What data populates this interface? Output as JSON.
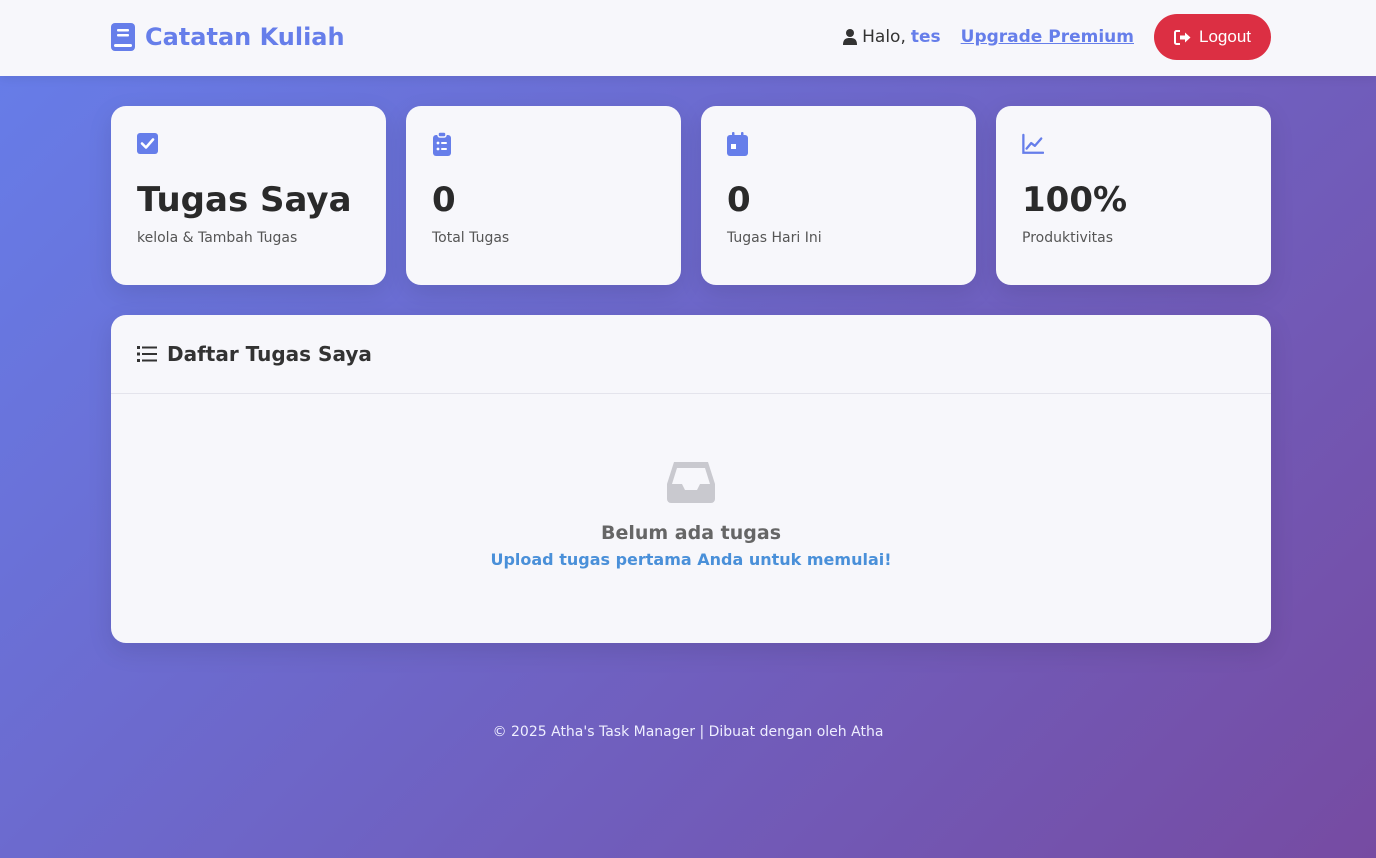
{
  "nav": {
    "brand": "Catatan Kuliah",
    "greeting": "Halo,",
    "username": "tes",
    "upgrade": "Upgrade Premium",
    "logout": "Logout"
  },
  "stats": [
    {
      "value": "Tugas Saya",
      "label": "kelola & Tambah Tugas",
      "icon": "check-square-icon"
    },
    {
      "value": "0",
      "label": "Total Tugas",
      "icon": "clipboard-list-icon"
    },
    {
      "value": "0",
      "label": "Tugas Hari Ini",
      "icon": "calendar-icon"
    },
    {
      "value": "100%",
      "label": "Produktivitas",
      "icon": "chart-line-icon"
    }
  ],
  "panel": {
    "title": "Daftar Tugas Saya",
    "empty_title": "Belum ada tugas",
    "empty_sub": "Upload tugas pertama Anda untuk memulai!"
  },
  "footer": "© 2025 Atha's Task Manager | Dibuat dengan oleh Atha",
  "colors": {
    "accent": "#667eea",
    "gradient_end": "#764ba2",
    "logout": "#dc2f43",
    "link": "#4a90d9"
  }
}
